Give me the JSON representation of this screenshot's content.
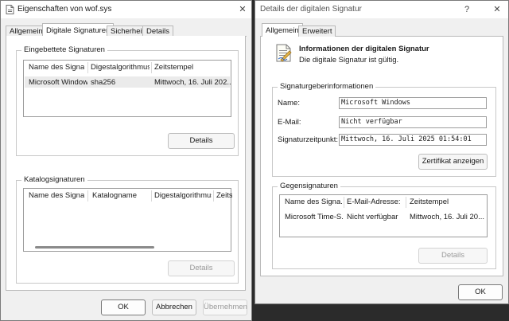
{
  "left_window": {
    "title": "Eigenschaften von wof.sys",
    "close_glyph": "✕",
    "tabs": [
      "Allgemein",
      "Digitale Signaturen",
      "Sicherheit",
      "Details"
    ],
    "embedded": {
      "label": "Eingebettete Signaturen",
      "columns": [
        "Name des Signa...",
        "Digestalgorithmus",
        "Zeitstempel"
      ],
      "rows": [
        [
          "Microsoft Windows",
          "sha256",
          "Mittwoch, 16. Juli 202..."
        ]
      ],
      "details_button": "Details"
    },
    "catalog": {
      "label": "Katalogsignaturen",
      "columns": [
        "Name des Signa...",
        "Katalogname",
        "Digestalgorithmus",
        "Zeits"
      ],
      "details_button": "Details"
    },
    "buttons": {
      "ok": "OK",
      "cancel": "Abbrechen",
      "apply": "Übernehmen"
    }
  },
  "right_window": {
    "title": "Details der digitalen Signatur",
    "help_glyph": "?",
    "close_glyph": "✕",
    "tabs": [
      "Allgemein",
      "Erweitert"
    ],
    "info_title": "Informationen der digitalen Signatur",
    "info_subtitle": "Die digitale Signatur ist gültig.",
    "signer": {
      "label": "Signaturgeberinformationen",
      "name_label": "Name:",
      "name_value": "Microsoft Windows",
      "email_label": "E-Mail:",
      "email_value": "Nicht verfügbar",
      "time_label": "Signaturzeitpunkt:",
      "time_value": "Mittwoch, 16. Juli 2025 01:54:01",
      "cert_button": "Zertifikat anzeigen"
    },
    "countersign": {
      "label": "Gegensignaturen",
      "columns": [
        "Name des Signa...",
        "E-Mail-Adresse:",
        "Zeitstempel"
      ],
      "rows": [
        [
          "Microsoft Time-S...",
          "Nicht verfügbar",
          "Mittwoch, 16. Juli 20..."
        ]
      ],
      "details_button": "Details"
    },
    "ok_button": "OK"
  }
}
